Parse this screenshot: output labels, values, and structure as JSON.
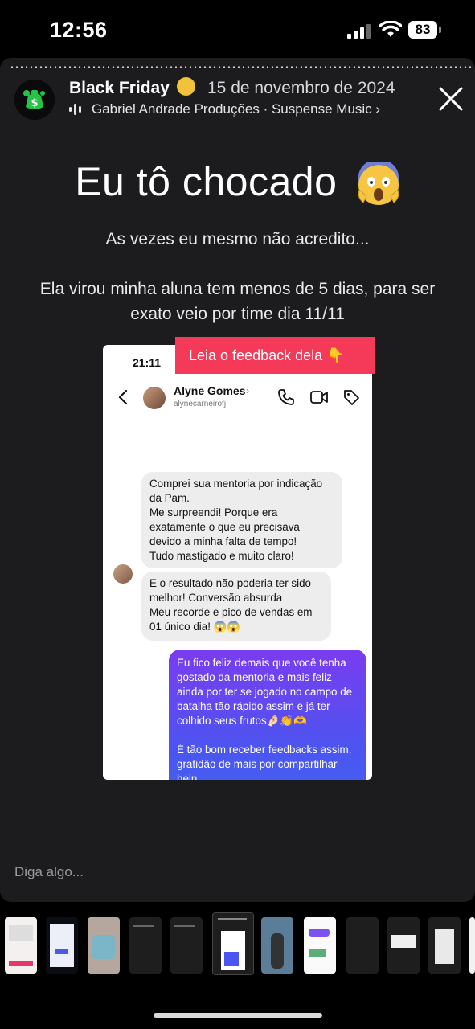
{
  "status_bar": {
    "time": "12:56",
    "battery": "83"
  },
  "story": {
    "title": "Black Friday",
    "date": "15 de novembro de 2024",
    "music": "Gabriel Andrade Produções · Suspense Music ›",
    "headline": "Eu tô chocado",
    "subtitle": "As vezes eu mesmo não acredito...",
    "body": "Ela virou minha aluna tem menos de 5 dias, para ser exato veio por time dia 11/11"
  },
  "chat": {
    "time": "21:11",
    "banner": "Leia o feedback dela 👇",
    "contact_name": "Alyne Gomes",
    "contact_username": "alynecarneirofj",
    "messages": [
      {
        "from": "them",
        "text": "Comprei sua mentoria por indicação da Pam.\nMe surpreendi! Porque era exatamente o que eu precisava devido a minha falta de tempo!\nTudo mastigado e muito claro!"
      },
      {
        "from": "them",
        "text": "E o resultado não poderia ter sido melhor! Conversão absurda\nMeu recorde e pico de vendas em 01 único dia! 😱😱"
      },
      {
        "from": "me",
        "text": "Eu fico feliz demais que você tenha gostado da mentoria e mais feliz ainda por ter se jogado no campo de batalha tão rápido assim e já ter colhido seus frutos🤌🏻👏🫶\n\nÉ tão bom receber feedbacks assim, gratidão de mais por compartilhar hein.\n\nPoderia me mandar seu resultado ou o print das vendas por gentileza?"
      }
    ]
  },
  "reply": {
    "placeholder": "Diga algo..."
  },
  "thumbnails": {
    "count": 12
  }
}
